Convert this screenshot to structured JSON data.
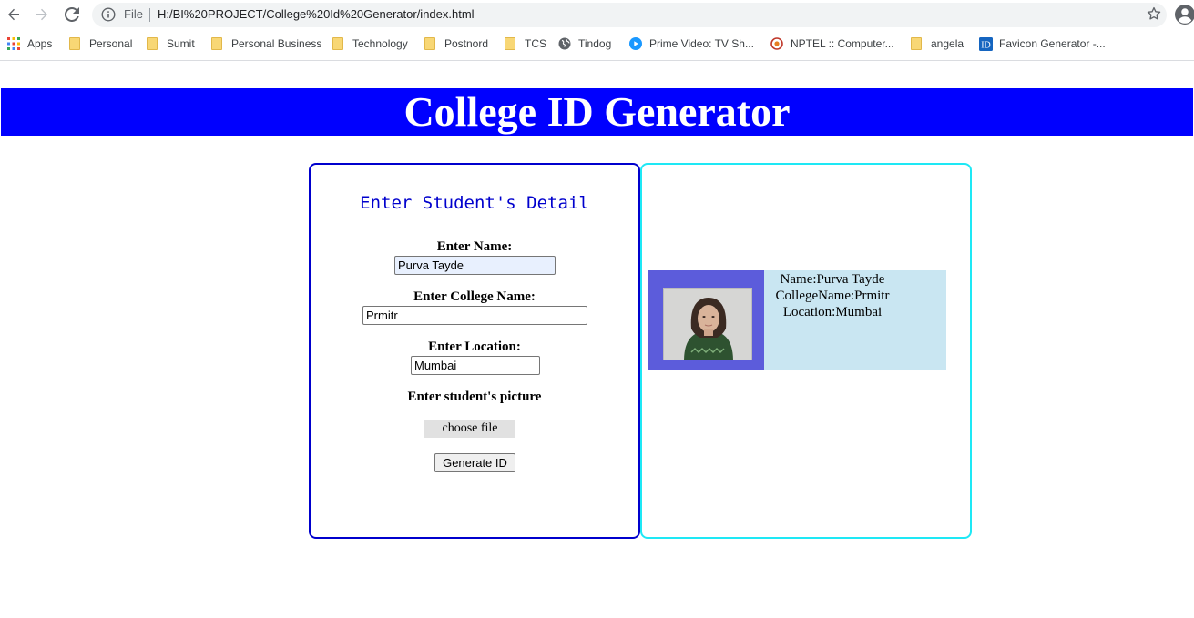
{
  "browser": {
    "omnibox": {
      "scheme_label": "File",
      "url": "H:/BI%20PROJECT/College%20Id%20Generator/index.html"
    },
    "bookmarks": [
      {
        "label": "Apps",
        "icon": "apps-grid-icon"
      },
      {
        "label": "Personal",
        "icon": "folder-icon"
      },
      {
        "label": "Sumit",
        "icon": "folder-icon"
      },
      {
        "label": "Personal Business",
        "icon": "folder-icon"
      },
      {
        "label": "Technology",
        "icon": "folder-icon"
      },
      {
        "label": "Postnord",
        "icon": "folder-icon"
      },
      {
        "label": "TCS",
        "icon": "folder-icon"
      },
      {
        "label": "Tindog",
        "icon": "globe-icon"
      },
      {
        "label": "Prime Video: TV Sh...",
        "icon": "prime-video-icon"
      },
      {
        "label": "NPTEL :: Computer...",
        "icon": "nptel-icon"
      },
      {
        "label": "angela",
        "icon": "folder-icon"
      },
      {
        "label": "Favicon Generator -...",
        "icon": "favicon-generator-icon"
      }
    ]
  },
  "page": {
    "title": "College ID Generator",
    "form": {
      "heading": "Enter Student's Detail",
      "name_label": "Enter Name:",
      "name_value": "Purva Tayde",
      "college_label": "Enter College Name:",
      "college_value": "Prmitr",
      "location_label": "Enter Location:",
      "location_value": "Mumbai",
      "picture_label": "Enter student's picture",
      "choose_file": "choose file",
      "generate": "Generate ID"
    },
    "id_card": {
      "name_line": "Name:Purva Tayde",
      "college_line": "CollegeName:Prmitr",
      "location_line": "Location:Mumbai"
    }
  },
  "colors": {
    "banner": "#0000ff",
    "form_border": "#0000cd",
    "card_border": "#1ee8f5",
    "id_card_bg": "#c9e6f2",
    "photo_bg": "#5c5cdb"
  }
}
